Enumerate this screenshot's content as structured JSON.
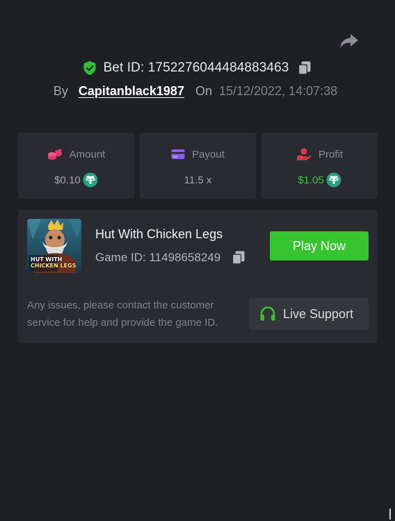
{
  "header": {
    "bet_id_label": "Bet ID: 1752276044484883463",
    "by_label": "By",
    "username": "Capitanblack1987",
    "on_label": "On",
    "datetime": "15/12/2022, 14:07:38"
  },
  "stats": {
    "amount": {
      "label": "Amount",
      "value": "$0.10",
      "icon": "coins-icon",
      "color": "#e0386f"
    },
    "payout": {
      "label": "Payout",
      "value": "11.5 x",
      "icon": "wallet-card-icon",
      "color": "#8a5cf6"
    },
    "profit": {
      "label": "Profit",
      "value": "$1.05",
      "icon": "hand-coin-icon",
      "color": "#e03a4a"
    }
  },
  "game": {
    "title": "Hut With Chicken Legs",
    "game_id_label": "Game ID: 11498658249",
    "thumb_text_line1": "HUT WITH",
    "thumb_text_line2": "CHICKEN LEGS",
    "play_label": "Play Now",
    "help_text": "Any issues, please contact the customer service for help and provide the game ID.",
    "support_label": "Live Support"
  },
  "colors": {
    "background": "#1f2024",
    "card": "#2a2b30",
    "accent_green": "#36c530",
    "tether_green": "#26a17b"
  },
  "icons": [
    "share-icon",
    "verified-shield-icon",
    "copy-icon",
    "tether-coin-icon",
    "headset-icon"
  ]
}
